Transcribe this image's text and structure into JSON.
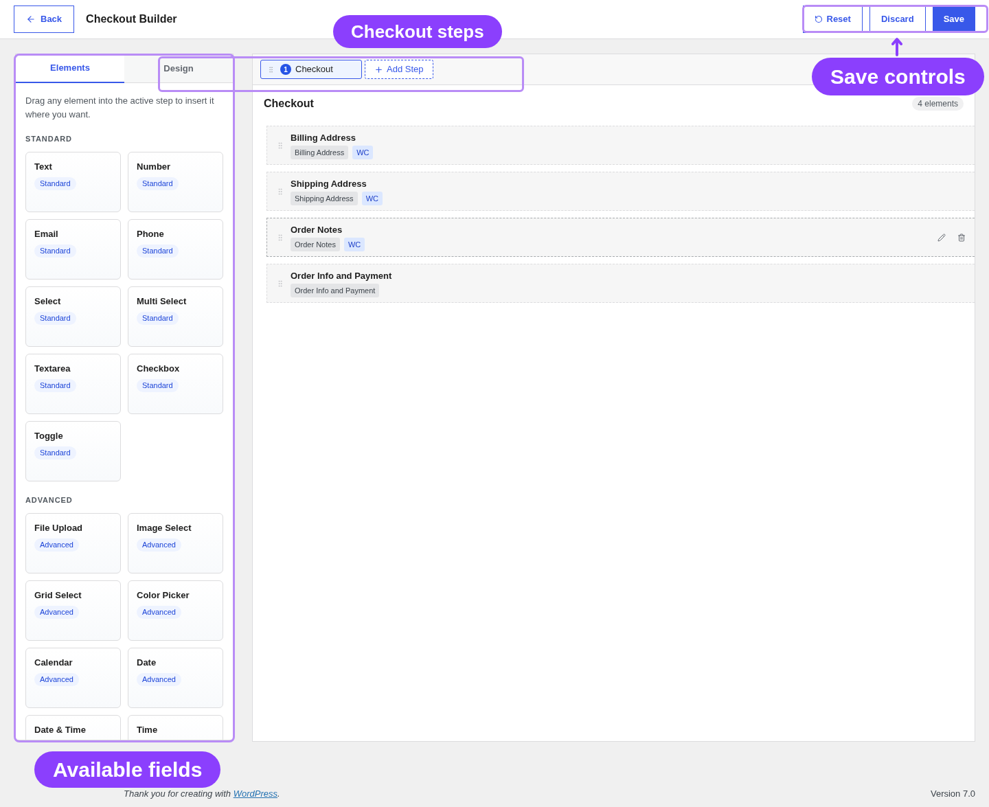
{
  "header": {
    "back_button": "Back",
    "title": "Checkout Builder",
    "actions": [
      {
        "label": "Reset",
        "kind": "reset"
      },
      {
        "label": "Discard",
        "kind": "secondary"
      },
      {
        "label": "Save",
        "kind": "primary"
      }
    ]
  },
  "sidebar": {
    "tabs": [
      {
        "label": "Elements",
        "selected": true
      },
      {
        "label": "Design",
        "selected": false
      }
    ],
    "description": "Drag any element into the active step to insert it where you want.",
    "groups": [
      {
        "heading": "STANDARD",
        "items": [
          {
            "label": "Text",
            "badge": "Standard"
          },
          {
            "label": "Number",
            "badge": "Standard"
          },
          {
            "label": "Email",
            "badge": "Standard"
          },
          {
            "label": "Phone",
            "badge": "Standard"
          },
          {
            "label": "Select",
            "badge": "Standard"
          },
          {
            "label": "Multi Select",
            "badge": "Standard"
          },
          {
            "label": "Textarea",
            "badge": "Standard"
          },
          {
            "label": "Checkbox",
            "badge": "Standard"
          },
          {
            "label": "Toggle",
            "badge": "Standard"
          }
        ]
      },
      {
        "heading": "ADVANCED",
        "items": [
          {
            "label": "File Upload",
            "badge": "Advanced"
          },
          {
            "label": "Image Select",
            "badge": "Advanced"
          },
          {
            "label": "Grid Select",
            "badge": "Advanced"
          },
          {
            "label": "Color Picker",
            "badge": "Advanced"
          },
          {
            "label": "Calendar",
            "badge": "Advanced"
          },
          {
            "label": "Date",
            "badge": "Advanced"
          },
          {
            "label": "Date & Time"
          },
          {
            "label": "Time"
          }
        ]
      }
    ]
  },
  "canvas": {
    "steps": [
      {
        "number": "1",
        "label": "Checkout",
        "selected": true
      }
    ],
    "add_step": "Add Step",
    "title": "Checkout",
    "count": "4 elements",
    "elements": [
      {
        "title": "Billing Address",
        "tags": [
          {
            "label": "Billing Address",
            "kind": "type"
          },
          {
            "label": "WC",
            "kind": "source"
          }
        ],
        "hovered": false
      },
      {
        "title": "Shipping Address",
        "tags": [
          {
            "label": "Shipping Address",
            "kind": "type"
          },
          {
            "label": "WC",
            "kind": "source"
          }
        ],
        "hovered": false
      },
      {
        "title": "Order Notes",
        "tags": [
          {
            "label": "Order Notes",
            "kind": "type"
          },
          {
            "label": "WC",
            "kind": "source"
          }
        ],
        "hovered": true
      },
      {
        "title": "Order Info and Payment",
        "tags": [
          {
            "label": "Order Info and Payment",
            "kind": "type"
          }
        ],
        "hovered": false
      }
    ]
  },
  "footer": {
    "credit_before": "Thank you for creating with",
    "credit_link": "WordPress",
    "credit_after": ".",
    "version": "Version 7.0"
  },
  "annotations": [
    {
      "kind": "steps",
      "label": "Checkout steps"
    },
    {
      "kind": "save",
      "label": "Save controls"
    },
    {
      "kind": "fields",
      "label": "Available fields"
    }
  ]
}
